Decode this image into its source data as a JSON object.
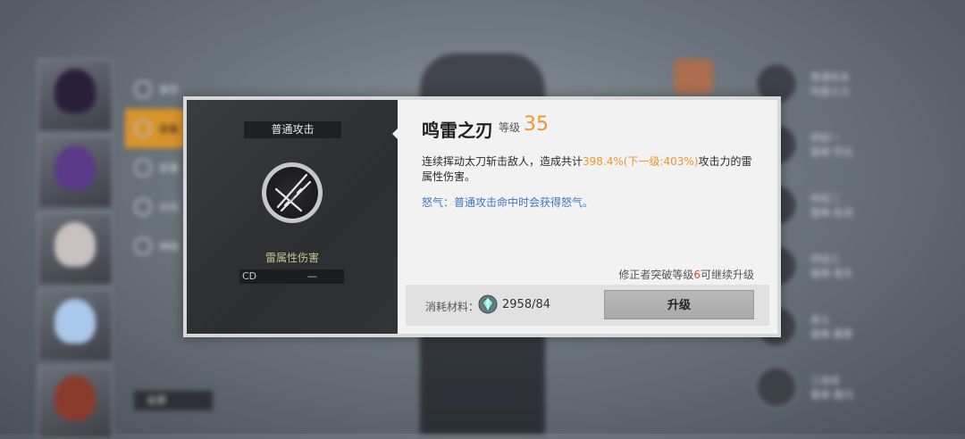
{
  "background": {
    "menu_items": [
      "属性",
      "装备",
      "部署",
      "共鸣",
      "神格"
    ],
    "all_button": "全部",
    "skills": [
      {
        "kind": "普通攻击",
        "name": "鸣雷之刃"
      },
      {
        "kind": "终结一",
        "name": "雷棒 烈光"
      },
      {
        "kind": "终结二",
        "name": "雷棒 收流"
      },
      {
        "kind": "终结三",
        "name": "雷棒 笼天"
      },
      {
        "kind": "奥义",
        "name": "雷棒 霹雳"
      },
      {
        "kind": "三连技",
        "name": "雷棒 轰闪"
      }
    ]
  },
  "dialog": {
    "tag": "普通攻击",
    "damage_type": "雷属性伤害",
    "cd_label": "CD",
    "cd_value": "—",
    "skill_name": "鸣雷之刃",
    "level_label": "等级",
    "level_value": "35",
    "desc_before": "连续挥动太刀斩击敌人，造成共计",
    "desc_highlight": "398.4%(下一级:403%)",
    "desc_after": "攻击力的雷属性伤害。",
    "rage_text": "怒气：普通攻击命中时会获得怒气。",
    "note_before": "修正者突破等级",
    "note_highlight": "6",
    "note_after": "可继续升级",
    "cost_label": "消耗材料：",
    "cost_value": "2958/84",
    "upgrade_label": "升级",
    "colors": {
      "accent": "#f0962b",
      "rage": "#3d75c8",
      "warn": "#e04545",
      "damage": "#c7c48c"
    },
    "icons": {
      "skill": "crossed-blades-icon",
      "material": "crystal-gem-icon"
    }
  }
}
